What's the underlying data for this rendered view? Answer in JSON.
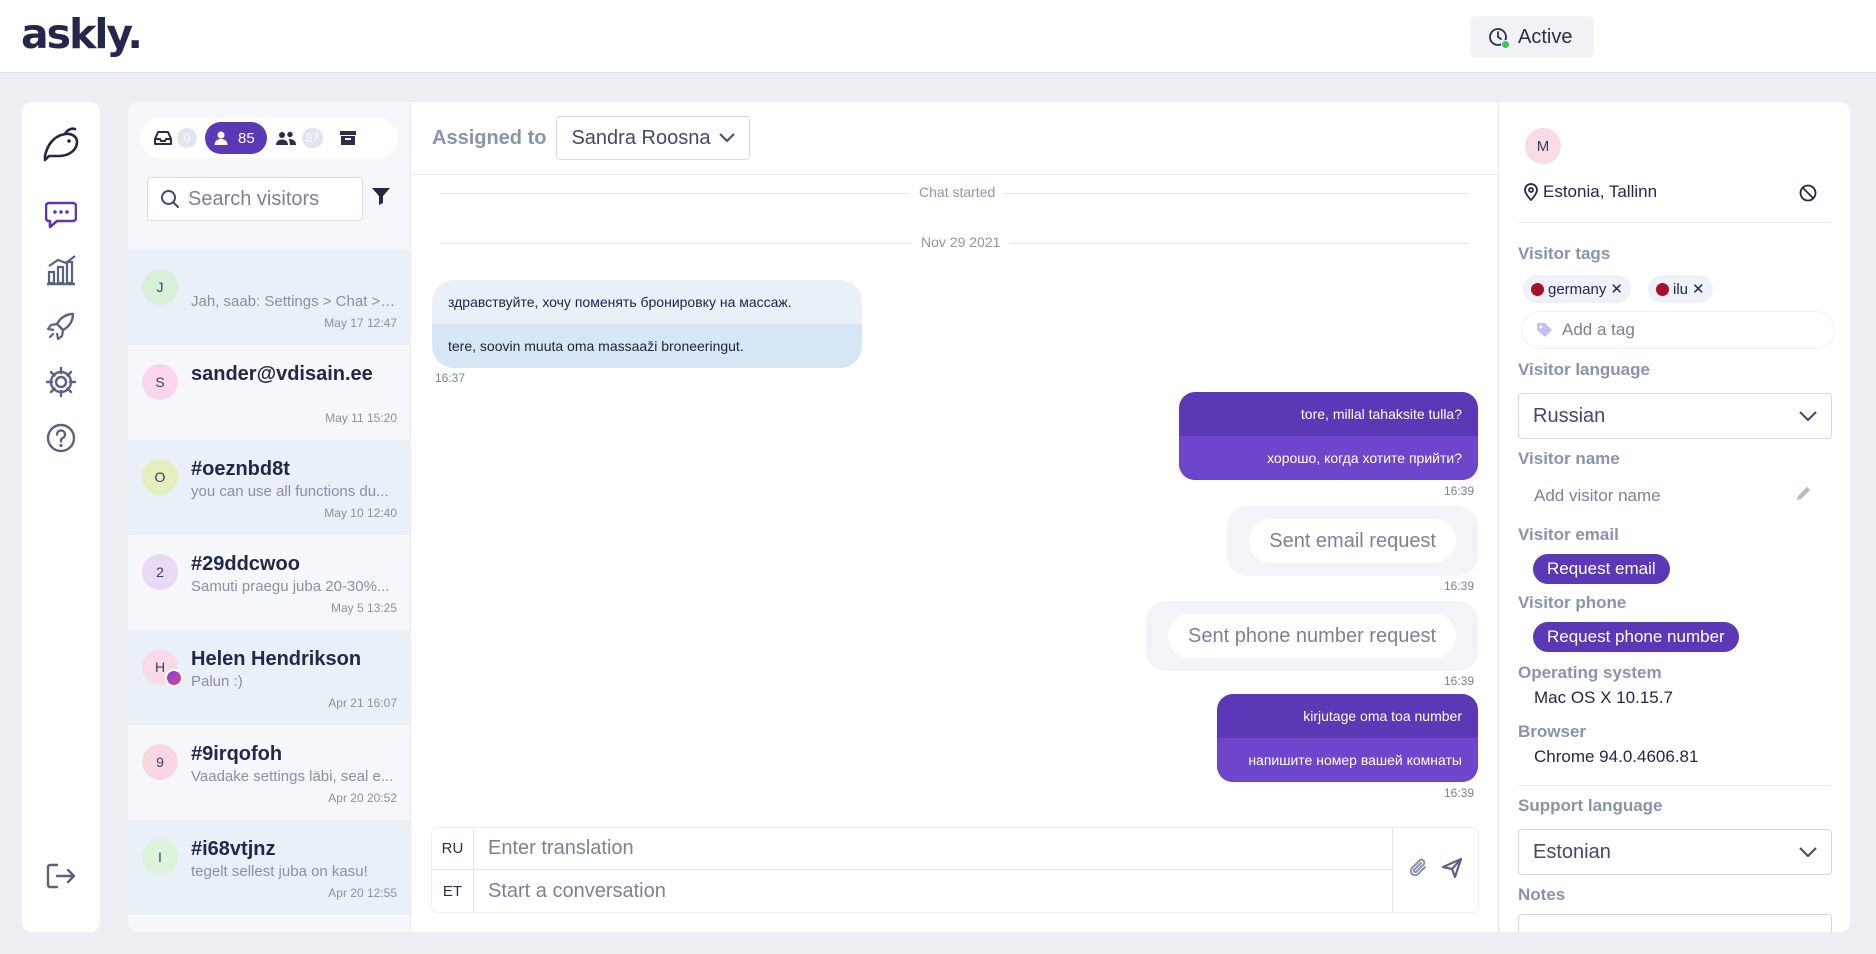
{
  "app": {
    "logo": "askly."
  },
  "status": {
    "label": "Active"
  },
  "filters": [
    {
      "name": "inbox",
      "count": "0"
    },
    {
      "name": "mine",
      "count": "85"
    },
    {
      "name": "team",
      "count": "87"
    },
    {
      "name": "archive",
      "count": ""
    }
  ],
  "search": {
    "placeholder": "Search visitors"
  },
  "conversations": [
    {
      "initial": "J",
      "name": "",
      "snippet": "Jah, saab: Settings > Chat > ...",
      "time": "May 17 12:47",
      "avatar_color": "#d8f0d8"
    },
    {
      "initial": "S",
      "name": "sander@vdisain.ee",
      "snippet": "",
      "time": "May 11 15:20",
      "avatar_color": "#f9d6ea"
    },
    {
      "initial": "O",
      "name": "#oeznbd8t",
      "snippet": "you can use all functions du...",
      "time": "May 10 12:40",
      "avatar_color": "#e4efbe"
    },
    {
      "initial": "2",
      "name": "#29ddcwoo",
      "snippet": "Samuti praegu juba 20-30%...",
      "time": "May 5 13:25",
      "avatar_color": "#ead9f4"
    },
    {
      "initial": "H",
      "name": "Helen Hendrikson",
      "snippet": "Palun :)",
      "time": "Apr 21 16:07",
      "avatar_color": "#f9dbe8"
    },
    {
      "initial": "9",
      "name": "#9irqofoh",
      "snippet": "Vaadake settings läbi, seal e...",
      "time": "Apr 20 20:52",
      "avatar_color": "#f8d7e2"
    },
    {
      "initial": "I",
      "name": "#i68vtjnz",
      "snippet": "tegelt sellest juba on kasu!",
      "time": "Apr 20 12:55",
      "avatar_color": "#dff3dc"
    }
  ],
  "chat": {
    "assigned_label": "Assigned to",
    "assignee": "Sandra Roosna",
    "started_label": "Chat started",
    "date_label": "Nov 29 2021",
    "messages": [
      {
        "original": "здравствуйте, хочу поменять бронировку на массаж.",
        "translation": "tere, soovin muuta oma massaaži broneeringut.",
        "time": "16:37"
      },
      {
        "original": "tore, millal tahaksite tulla?",
        "translation": "хорошо, когда хотите прийти?",
        "time": "16:39"
      },
      {
        "request": "Sent email request",
        "time": "16:39"
      },
      {
        "request": "Sent phone number request",
        "time": "16:39"
      },
      {
        "original": "kirjutage oma toa number",
        "translation": "напишите номер вашей комнаты",
        "time": "16:39"
      }
    ],
    "composer": {
      "lang_top": "RU",
      "lang_bottom": "ET",
      "placeholder_top": "Enter translation",
      "placeholder_bottom": "Start a conversation"
    }
  },
  "visitor": {
    "initial": "M",
    "location": "Estonia, Tallinn",
    "tags_label": "Visitor tags",
    "tags": [
      "germany",
      "ilu"
    ],
    "add_tag_placeholder": "Add a tag",
    "language_label": "Visitor language",
    "language": "Russian",
    "name_label": "Visitor name",
    "name_placeholder": "Add visitor name",
    "email_label": "Visitor email",
    "email_button": "Request email",
    "phone_label": "Visitor phone",
    "phone_button": "Request phone number",
    "os_label": "Operating system",
    "os": "Mac OS X 10.15.7",
    "browser_label": "Browser",
    "browser": "Chrome 94.0.4606.81",
    "support_language_label": "Support language",
    "support_language": "Estonian",
    "notes_label": "Notes"
  },
  "colors": {
    "accent": "#5b38b5",
    "accent_light": "#6e46cc",
    "status_green": "#3cc35a",
    "tag_red": "#a8102a"
  }
}
